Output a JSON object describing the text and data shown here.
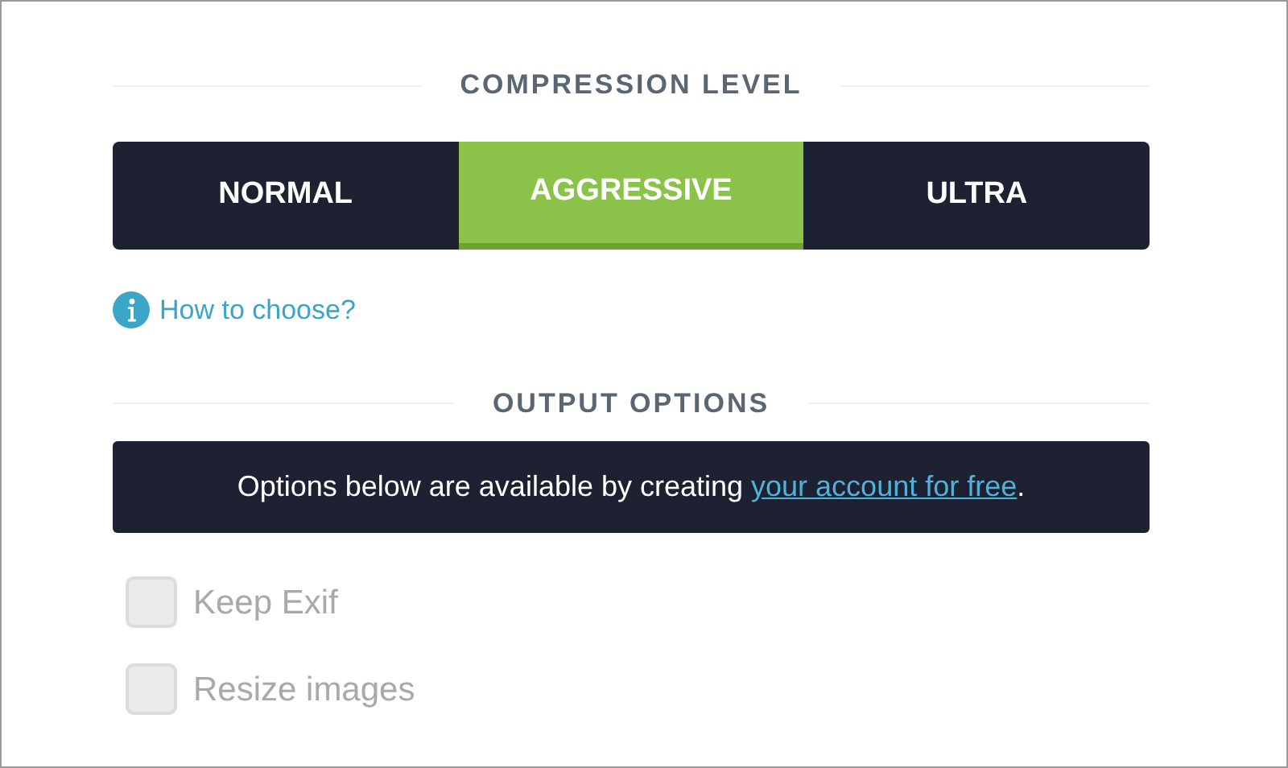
{
  "compression": {
    "heading": "COMPRESSION LEVEL",
    "levels": [
      {
        "label": "NORMAL",
        "selected": false
      },
      {
        "label": "AGGRESSIVE",
        "selected": true
      },
      {
        "label": "ULTRA",
        "selected": false
      }
    ],
    "help_link": "How to choose?"
  },
  "output": {
    "heading": "OUTPUT OPTIONS",
    "notice": {
      "text": "Options below are available by creating ",
      "link": "your account for free",
      "after": "."
    },
    "options": [
      {
        "label": "Keep Exif",
        "checked": false,
        "disabled": true
      },
      {
        "label": "Resize images",
        "checked": false,
        "disabled": true
      }
    ]
  }
}
